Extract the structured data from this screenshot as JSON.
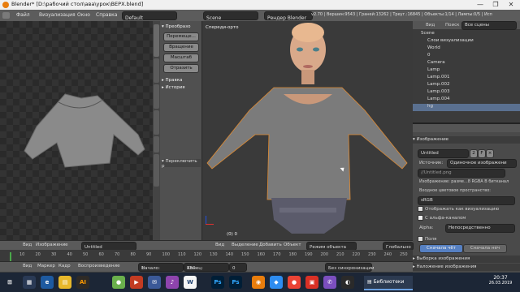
{
  "window": {
    "title": "Blender* [D:\\рабочий стол\\ава\\урок\\BEPX.blend]",
    "controls": [
      "—",
      "❐",
      "✕"
    ]
  },
  "menubar": {
    "items": [
      "Файл",
      "Визуализация",
      "Окно",
      "Справка"
    ],
    "layout": "Default",
    "scene": "Scene",
    "engine": "Рендер Blender",
    "stats": "v2.70 | Вершин:9543 | Граней:13262 | Треуг.:16845 | Объекты:1/14 | Лампы:0/5 | Исп"
  },
  "toolshelf": {
    "header": "Преобразо",
    "buttons": [
      "Перемеще...",
      "Вращение",
      "Масштаб",
      "Отразить"
    ],
    "sections": [
      "Правка",
      "История"
    ],
    "operator": "Переключить р",
    "tabs": [
      "Инструменты",
      "Создать",
      "Отношения",
      "Анимация",
      "Физика",
      "Эскиз.ный-каранд"
    ]
  },
  "viewport": {
    "label": "Спереди-орто",
    "object_label": "(0) 0"
  },
  "outliner": {
    "tabs": [
      "Вид",
      "Поиск",
      "Все сцены"
    ],
    "items": [
      {
        "name": "Scene"
      },
      {
        "name": "Слои визуализации"
      },
      {
        "name": "World"
      },
      {
        "name": "0"
      },
      {
        "name": "Camera"
      },
      {
        "name": "Lamp"
      },
      {
        "name": "Lamp.001"
      },
      {
        "name": "Lamp.002"
      },
      {
        "name": "Lamp.003"
      },
      {
        "name": "Lamp.004"
      },
      {
        "name": "hg"
      }
    ]
  },
  "properties": {
    "section": "Изображение",
    "image_name": "Untitled",
    "users": "2",
    "source_label": "Источник:",
    "source_value": "Одиночное изображени",
    "filepath": "//Untitled.png",
    "image_info": "Изображение: разме...8 RGBA B битканал",
    "color_space_label": "Входное цветовое пространство:",
    "color_space": "sRGB",
    "checkboxes": [
      {
        "label": "Отображать как визуализацию",
        "checked": false
      },
      {
        "label": "С альфа-каналом",
        "checked": true
      }
    ],
    "alpha_label": "Alpha:",
    "alpha_value": "Непосредственно",
    "fields_label": "Поля",
    "order_buttons": [
      "Сначала чёт",
      "Сначала неч"
    ],
    "sections": [
      "Выборка изображения",
      "Наложение изображения"
    ]
  },
  "image_editor_bar": {
    "items": [
      "Вид",
      "Изображение"
    ],
    "image": "Untitled",
    "users": "2",
    "buttons": [
      "F",
      "×"
    ]
  },
  "viewport_bar": {
    "items": [
      "Вид",
      "Выделение",
      "Добавить",
      "Объект"
    ],
    "mode": "Режим объекта",
    "shading": "Глобально"
  },
  "timeline": {
    "ticks": [
      "10",
      "20",
      "30",
      "40",
      "50",
      "60",
      "70",
      "80",
      "90",
      "100",
      "110",
      "120",
      "130",
      "140",
      "150",
      "160",
      "170",
      "180",
      "190",
      "200",
      "210",
      "220",
      "230",
      "240",
      "250"
    ],
    "menu": [
      "Вид",
      "Маркер",
      "Кадр",
      "Воспроизведение"
    ],
    "start": "Начало:",
    "start_value": "1",
    "end": "Конец:",
    "end_value": "250",
    "current": "0",
    "sync": "Без синхронизации"
  },
  "taskbar": {
    "apps": [
      {
        "label": "AI",
        "color": "#ff9a00"
      },
      {
        "label": "Ps",
        "color": "#31a8ff"
      },
      {
        "label": "Ps",
        "color": "#31a8ff"
      }
    ],
    "library": "Библиотеки",
    "time": "20:37",
    "date": "26.03.2019"
  }
}
